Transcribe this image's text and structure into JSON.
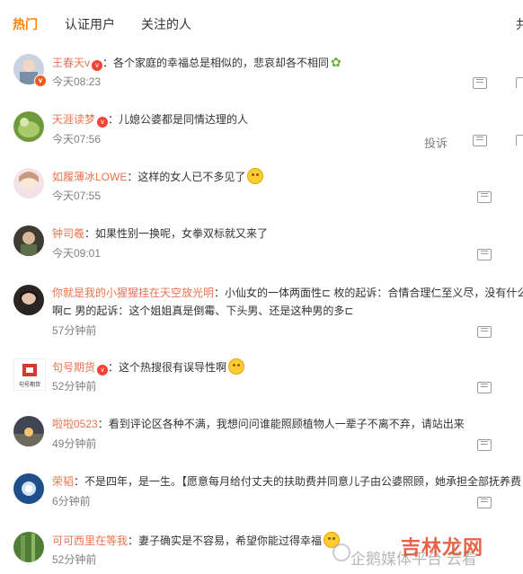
{
  "tabs": [
    "热门",
    "认证用户",
    "关注的人",
    "共"
  ],
  "colors": {
    "accent": "#ff8200",
    "username": "#eb7350",
    "time": "#808080"
  },
  "comments": [
    {
      "user": "王春天v",
      "text": "：各个家庭的幸福总是相似的，悲哀却各不相同",
      "time": "今天08:23",
      "emoji": "leaf-emoji"
    },
    {
      "user": "天涯读梦",
      "text": "：儿媳公婆都是同情达理的人",
      "time": "今天07:56",
      "report": "投诉"
    },
    {
      "user": "如履薄冰LOWE",
      "text": "：这样的女人已不多见了",
      "time": "今天07:55"
    },
    {
      "user": "钟司羲",
      "text": "：如果性别一换呢，女拳双标就又来了",
      "time": "今天09:01"
    },
    {
      "user": "你就是我的小猩猩挂在天空放光明",
      "text": "：小仙女的一体两面性⊏ 枚的起诉：合情合理仁至义尽，没有什么",
      "text2": "啊⊏ 男的起诉：这个姐姐真是倒霉、下头男、还是这种男的多⊏",
      "time": "57分钟前"
    },
    {
      "user": "句号期货",
      "text": "：这个热搜很有误导性啊",
      "time": "52分钟前",
      "logo_text": "句号期货"
    },
    {
      "user": "啦啦0523",
      "text": "：看到评论区各种不满，我想问问谁能照顾植物人一辈子不离不弃，请站出来",
      "time": "49分钟前"
    },
    {
      "user": "荣韬",
      "text": "：不是四年，是一生。【愿意每月给付丈夫的扶助费并同意儿子由公婆照顾，她承担全部抚养费",
      "time": "6分钟前"
    },
    {
      "user": "可可西里在等我",
      "text": "：妻子确实是不容易，希望你能过得幸福",
      "time": "52分钟前"
    }
  ],
  "watermark": {
    "main": "吉林龙网",
    "sub": "企鹅媒体平台 云看"
  }
}
